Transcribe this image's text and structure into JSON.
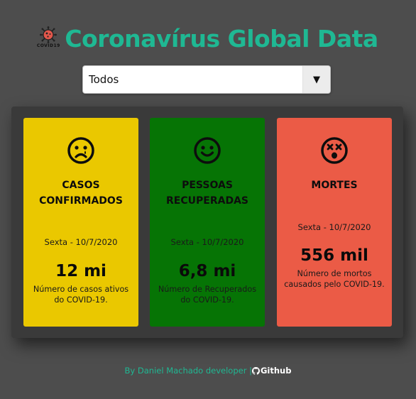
{
  "header": {
    "logo_text": "COVID19",
    "title": "Coronavírus Global Data"
  },
  "select": {
    "value": "Todos",
    "arrow": "▼"
  },
  "cards": [
    {
      "label_line1": "CASOS",
      "label_line2": "CONFIRMADOS",
      "date": "Sexta - 10/7/2020",
      "value": "12 mi",
      "desc_line1": "Número de casos ativos",
      "desc_line2": "do COVID-19.",
      "icon": "sad-face-icon",
      "color": "#eac800"
    },
    {
      "label_line1": "PESSOAS",
      "label_line2": "RECUPERADAS",
      "date": "Sexta - 10/7/2020",
      "value": "6,8 mi",
      "desc_line1": "Número de Recuperados",
      "desc_line2": "do COVID-19.",
      "icon": "smile-face-icon",
      "color": "#067405"
    },
    {
      "label_line1": "MORTES",
      "date": "Sexta - 10/7/2020",
      "value": "556 mil",
      "desc_line1": "Número de mortos",
      "desc_line2": "causados pelo COVID-19.",
      "icon": "dead-face-icon",
      "color": "#eb5b46"
    }
  ],
  "footer": {
    "credit": "By Daniel Machado developer",
    "separator": "|",
    "github_label": "Github"
  },
  "colors": {
    "background": "#4d4d4d",
    "accent": "#1fb893",
    "panel": "#3a3a3a"
  }
}
